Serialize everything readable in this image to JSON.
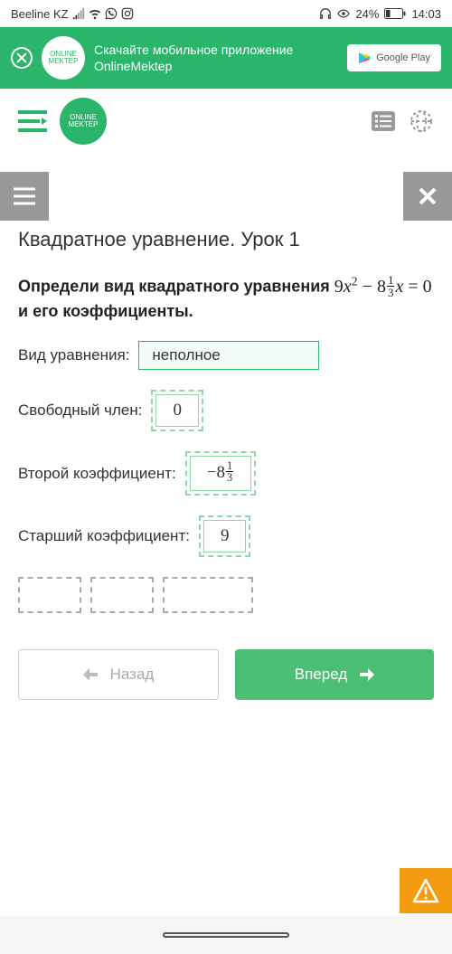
{
  "status": {
    "carrier": "Beeline KZ",
    "battery_pct": "24%",
    "time": "14:03"
  },
  "banner": {
    "logo_text": "ONLINE\nMEKTEP",
    "text": "Скачайте мобильное приложение OnlineMektep",
    "gplay": "Google Play"
  },
  "header": {
    "logo_text": "ONLINE\nMEKTEP"
  },
  "lesson": {
    "title": "Квадратное уравнение. Урок 1",
    "question_pre": "Определи вид квадратного уравнения",
    "question_post": "и его коэффициенты.",
    "eq_a": "9",
    "eq_b_int": "8",
    "eq_b_num": "1",
    "eq_b_den": "3",
    "eq_rhs": "0"
  },
  "fields": {
    "type_label": "Вид уравнения:",
    "type_value": "неполное",
    "free_label": "Свободный член:",
    "free_value": "0",
    "second_label": "Второй коэффициент:",
    "second_value_int": "−8",
    "second_value_num": "1",
    "second_value_den": "3",
    "leading_label": "Старший коэффициент:",
    "leading_value": "9"
  },
  "nav": {
    "back": "Назад",
    "next": "Вперед"
  }
}
